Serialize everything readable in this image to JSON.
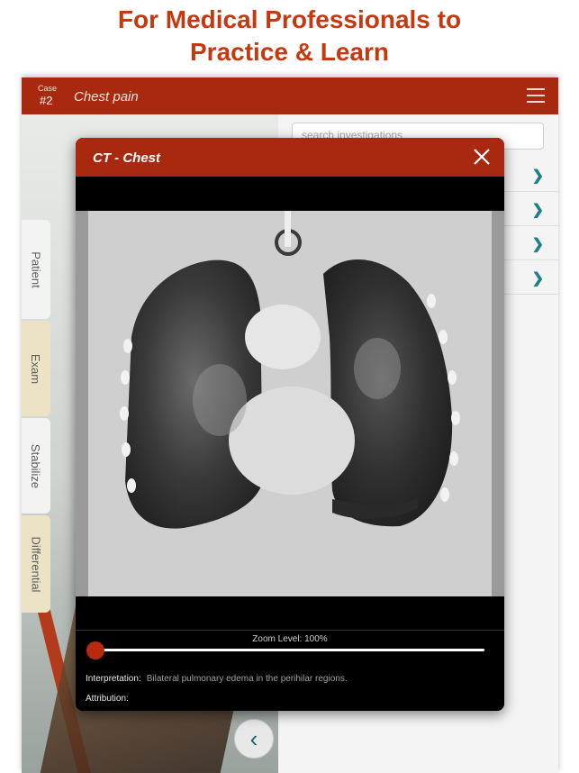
{
  "headline": {
    "line1": "For Medical Professionals to",
    "line2": "Practice & Learn"
  },
  "app_bar": {
    "case_label": "Case",
    "case_number": "#2",
    "title": "Chest pain",
    "menu_icon": "hamburger-menu-icon"
  },
  "side_tabs": [
    {
      "label": "Patient"
    },
    {
      "label": "Exam"
    },
    {
      "label": "Stabilize"
    },
    {
      "label": "Differential"
    }
  ],
  "investigations": {
    "search_placeholder": "search investigations"
  },
  "modal": {
    "title": "CT - Chest",
    "zoom_label": "Zoom Level: 100%",
    "zoom_level_fraction": 0,
    "interpretation_label": "Interpretation:",
    "interpretation_value": "Bilateral pulmonary edema in the perihilar regions.",
    "attribution_label": "Attribution:",
    "attribution_value": ""
  },
  "colors": {
    "headline": "#c4390f",
    "brand_bar": "#a8290f",
    "slider_thumb": "#b82a0d",
    "chevron": "#1f7f86"
  }
}
